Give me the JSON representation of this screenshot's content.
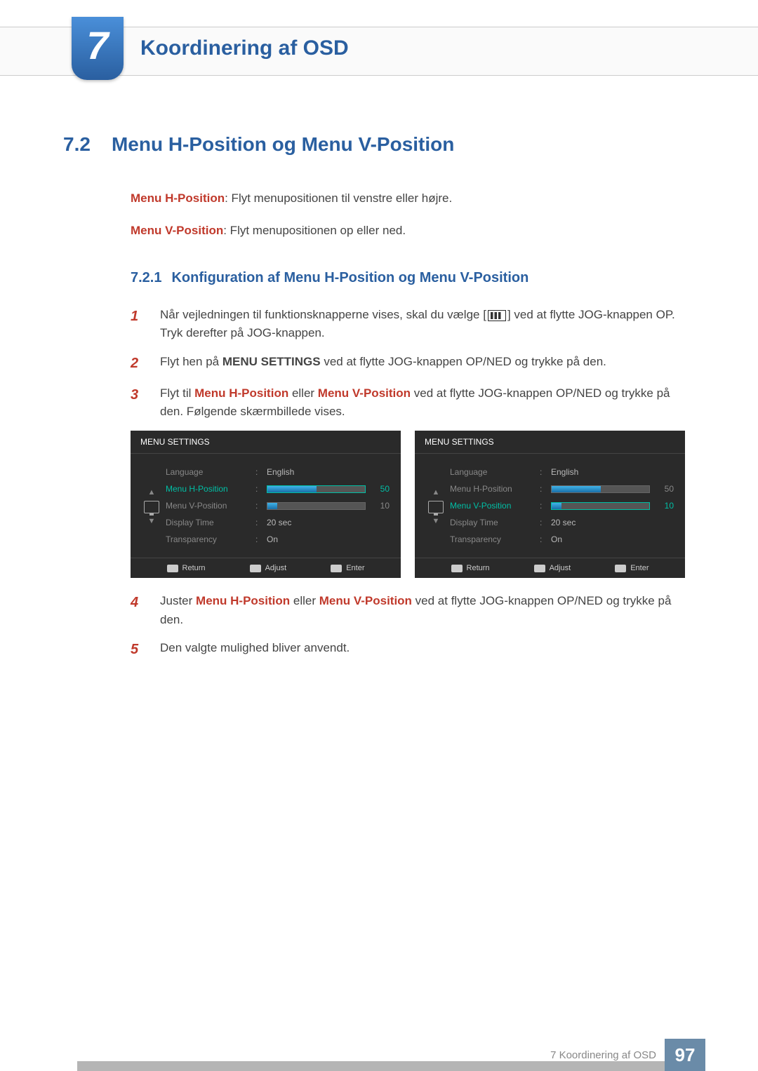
{
  "chapter": {
    "number": "7",
    "title": "Koordinering af OSD"
  },
  "section": {
    "number": "7.2",
    "title": "Menu H-Position og Menu V-Position"
  },
  "desc1": {
    "term": "Menu H-Position",
    "text": ": Flyt menupositionen til venstre eller højre."
  },
  "desc2": {
    "term": "Menu V-Position",
    "text": ": Flyt menupositionen op eller ned."
  },
  "subsection": {
    "number": "7.2.1",
    "title": "Konfiguration af Menu H-Position og Menu V-Position"
  },
  "steps": {
    "s1a": "Når vejledningen til funktionsknapperne vises, skal du vælge [",
    "s1b": "] ved at flytte JOG-knappen OP. Tryk derefter på JOG-knappen.",
    "s2a": "Flyt hen på ",
    "s2term": "MENU SETTINGS",
    "s2b": " ved at flytte JOG-knappen OP/NED og trykke på den.",
    "s3a": "Flyt til ",
    "s3t1": "Menu H-Position",
    "s3mid": " eller ",
    "s3t2": "Menu V-Position",
    "s3b": " ved at flytte JOG-knappen OP/NED og trykke på den. Følgende skærmbillede vises.",
    "s4a": "Juster ",
    "s4t1": "Menu H-Position",
    "s4mid": " eller ",
    "s4t2": "Menu V-Position",
    "s4b": " ved at flytte JOG-knappen OP/NED og trykke på den.",
    "s5": "Den valgte mulighed bliver anvendt."
  },
  "osd": {
    "title": "MENU SETTINGS",
    "rows": {
      "language": "Language",
      "hpos": "Menu H-Position",
      "vpos": "Menu V-Position",
      "dtime": "Display Time",
      "trans": "Transparency"
    },
    "values": {
      "language": "English",
      "hpos": "50",
      "vpos": "10",
      "dtime": "20 sec",
      "trans": "On"
    },
    "footer": {
      "return": "Return",
      "adjust": "Adjust",
      "enter": "Enter"
    }
  },
  "footer": {
    "label": "7 Koordinering af OSD",
    "page": "97"
  }
}
